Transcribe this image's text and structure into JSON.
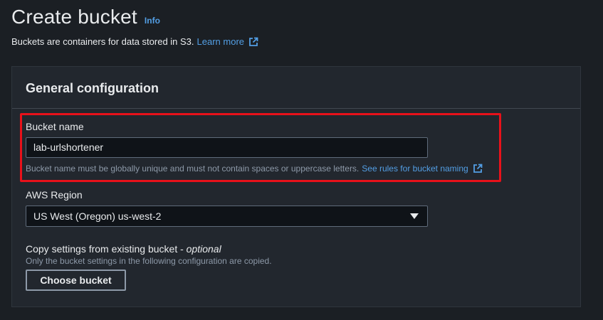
{
  "header": {
    "title": "Create bucket",
    "info_label": "Info",
    "description": "Buckets are containers for data stored in S3.",
    "learn_more": "Learn more"
  },
  "panel": {
    "title": "General configuration"
  },
  "bucket_name": {
    "label": "Bucket name",
    "value": "lab-urlshortener",
    "hint": "Bucket name must be globally unique and must not contain spaces or uppercase letters.",
    "rules_link": "See rules for bucket naming"
  },
  "region": {
    "label": "AWS Region",
    "selected": "US West (Oregon) us-west-2"
  },
  "copy_settings": {
    "label": "Copy settings from existing bucket - ",
    "optional": "optional",
    "description": "Only the bucket settings in the following configuration are copied.",
    "button_label": "Choose bucket"
  },
  "colors": {
    "background": "#1b1f24",
    "panel": "#22272e",
    "link": "#539fe5",
    "highlight": "#e8111a"
  },
  "icons": [
    "external-link-icon",
    "caret-down-icon"
  ]
}
